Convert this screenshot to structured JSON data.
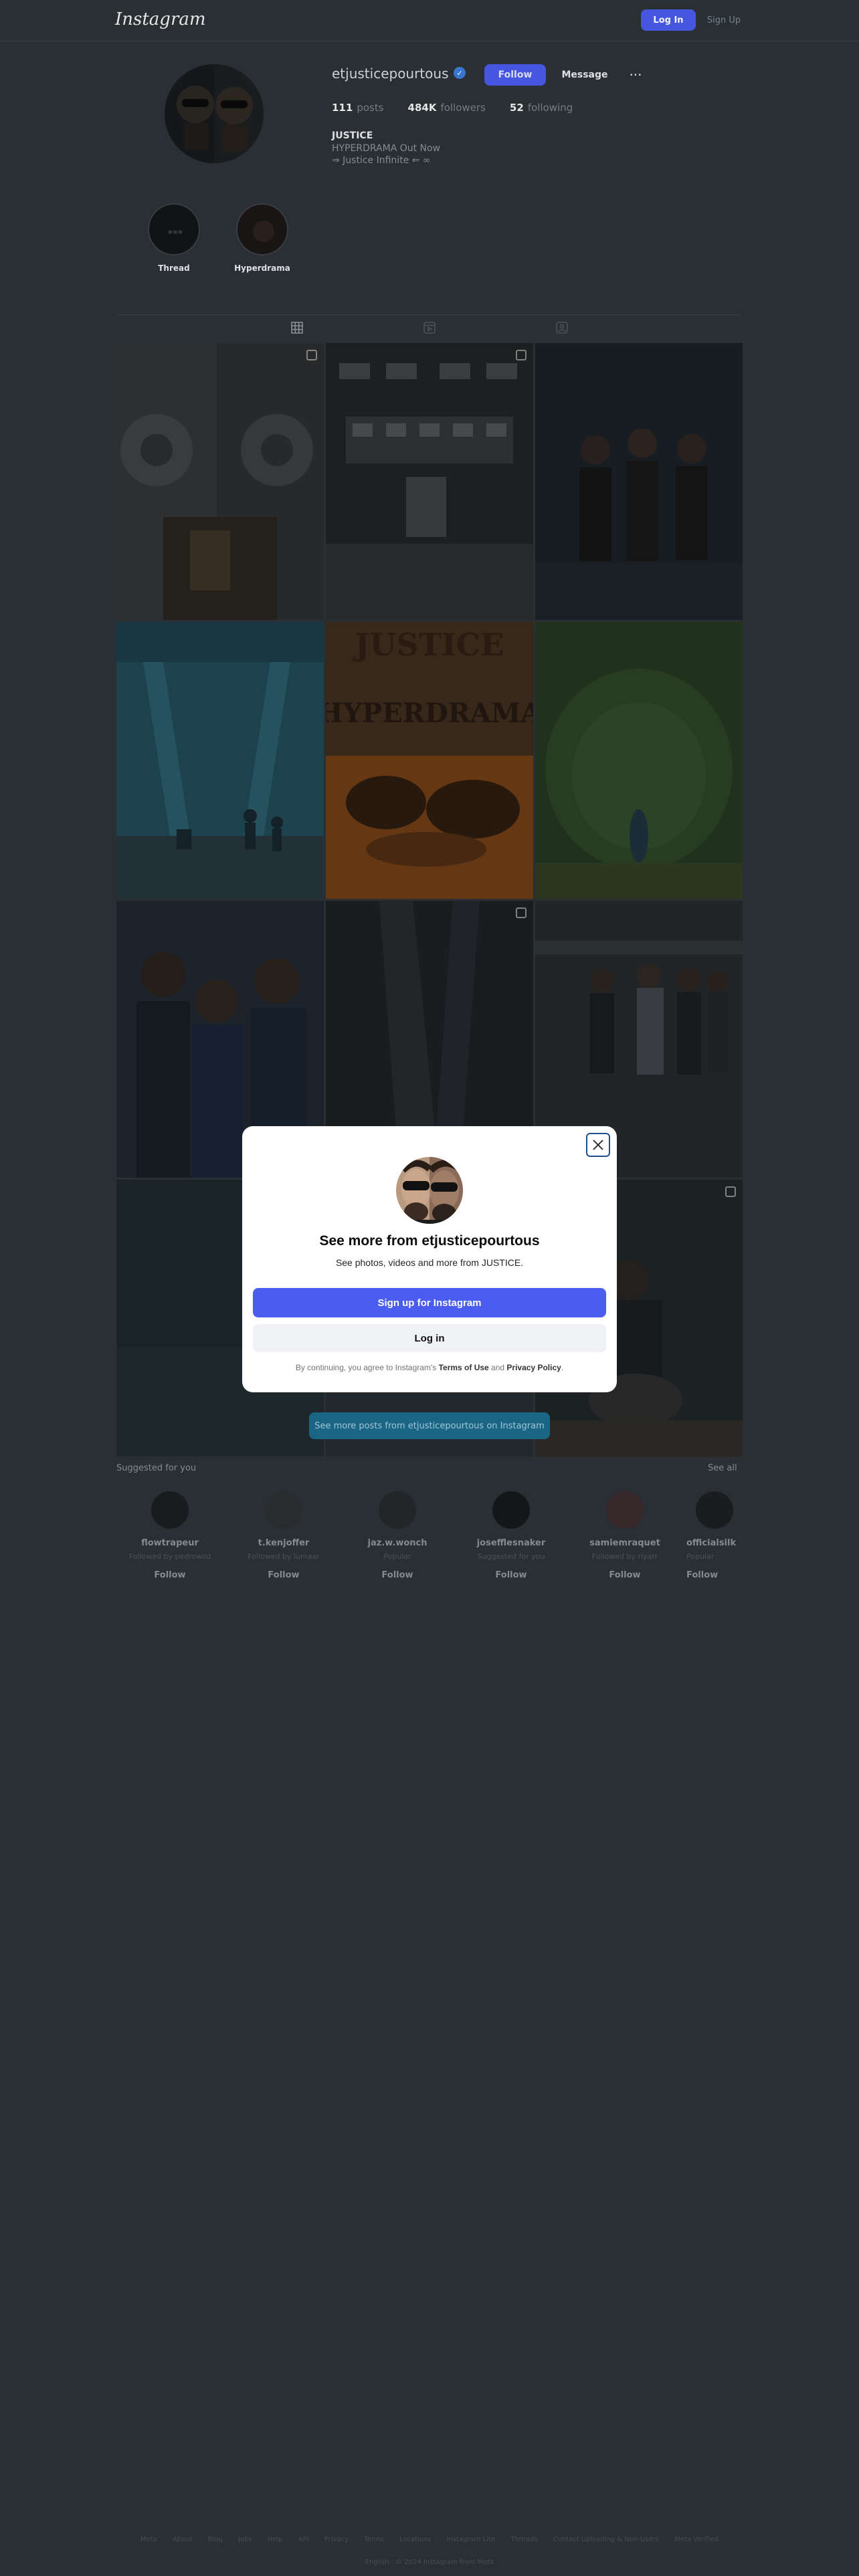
{
  "header": {
    "logo": "Instagram",
    "login_label": "Log In",
    "signup_label": "Sign Up"
  },
  "profile": {
    "username": "etjusticepourtous",
    "follow_label": "Follow",
    "message_label": "Message",
    "more_label": "···",
    "posts_count": "111",
    "posts_label": "posts",
    "followers_count": "484K",
    "followers_label": "followers",
    "following_count": "52",
    "following_label": "following",
    "bio_name": "JUSTICE",
    "bio_line1": "HYPERDRAMA Out Now",
    "bio_line2": "⇒ Justice Infinite ⇐ ∞"
  },
  "highlights": [
    {
      "label": "Thread"
    },
    {
      "label": "Hyperdrama"
    }
  ],
  "tabs": [
    "posts",
    "reels",
    "tagged"
  ],
  "grid": {
    "tiles": [
      {
        "kind": "speakers",
        "multi": true
      },
      {
        "kind": "stage",
        "multi": true
      },
      {
        "kind": "band-dark",
        "multi": false
      },
      {
        "kind": "concert-blue",
        "multi": false
      },
      {
        "kind": "poster",
        "multi": false,
        "poster_lines": [
          "JUSTICE",
          "HYPERDRAMA"
        ]
      },
      {
        "kind": "peacock",
        "multi": false
      },
      {
        "kind": "band-night",
        "multi": false
      },
      {
        "kind": "dark-stage",
        "multi": true
      },
      {
        "kind": "band-hall",
        "multi": false
      },
      {
        "kind": "dark-teal",
        "multi": false
      },
      {
        "kind": "dark-mid",
        "multi": false
      },
      {
        "kind": "guitar",
        "multi": true
      }
    ],
    "see_more": "See more posts from etjusticepourtous on Instagram"
  },
  "suggested": {
    "heading": "Suggested for you",
    "see_all": "See all",
    "accounts": [
      {
        "name": "flowtrapeur",
        "sub": "Followed by pedrowild",
        "follow": "Follow"
      },
      {
        "name": "t.kenjoffer",
        "sub": "Followed by lumaar",
        "follow": "Follow"
      },
      {
        "name": "jaz.w.wonch",
        "sub": "Popular",
        "follow": "Follow"
      },
      {
        "name": "josefflesnaker",
        "sub": "Suggested for you",
        "follow": "Follow"
      },
      {
        "name": "samiemraquet",
        "sub": "Followed by riyarr",
        "follow": "Follow"
      },
      {
        "name": "officialsilk",
        "sub": "Popular",
        "follow": "Follow"
      }
    ]
  },
  "footer": {
    "links": [
      "Meta",
      "About",
      "Blog",
      "Jobs",
      "Help",
      "API",
      "Privacy",
      "Terms",
      "Locations",
      "Instagram Lite",
      "Threads",
      "Contact Uploading & Non-Users",
      "Meta Verified"
    ],
    "copyright": "English · © 2024 Instagram from Meta"
  },
  "modal": {
    "title": "See more from etjusticepourtous",
    "subtitle": "See photos, videos and more from JUSTICE.",
    "signup_label": "Sign up for Instagram",
    "login_label": "Log in",
    "legal_prefix": "By continuing, you agree to Instagram's ",
    "terms_label": "Terms of Use",
    "legal_and": " and ",
    "privacy_label": "Privacy Policy",
    "legal_suffix": "."
  },
  "colors": {
    "accent": "#4a5df0",
    "page_dim": "#2c3136",
    "modal_bg": "#ffffff",
    "close_border": "#1d4f8c"
  }
}
